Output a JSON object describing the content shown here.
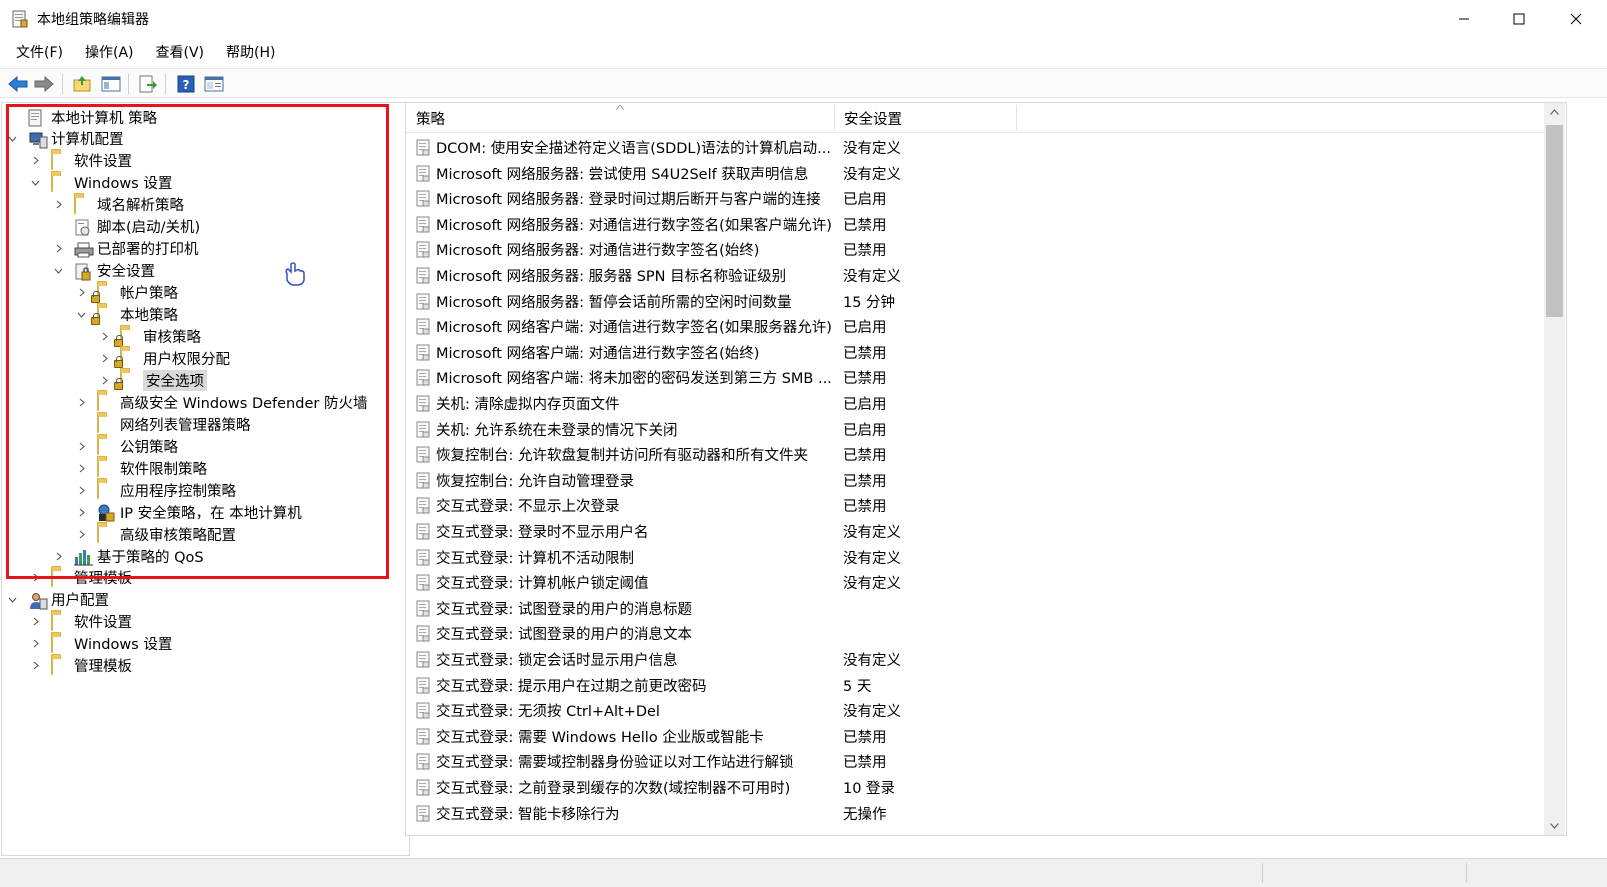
{
  "window": {
    "title": "本地组策略编辑器",
    "controls": [
      "minimize",
      "maximize",
      "close"
    ]
  },
  "menu": [
    "文件(F)",
    "操作(A)",
    "查看(V)",
    "帮助(H)"
  ],
  "toolbar": {
    "buttons": [
      "back-arrow-icon",
      "forward-arrow-icon",
      "up-folder-icon",
      "show-hide-tree-icon",
      "export-list-icon",
      "help-icon",
      "properties-icon"
    ]
  },
  "tree": [
    {
      "label": "本地计算机 策略",
      "icon": "policy-doc-icon",
      "depth": 0,
      "expander": "none"
    },
    {
      "label": "计算机配置",
      "icon": "computer-icon",
      "depth": 0,
      "expander": "expanded"
    },
    {
      "label": "软件设置",
      "icon": "folder-icon",
      "depth": 1,
      "expander": "collapsed"
    },
    {
      "label": "Windows 设置",
      "icon": "folder-icon",
      "depth": 1,
      "expander": "expanded"
    },
    {
      "label": "域名解析策略",
      "icon": "folder-icon",
      "depth": 2,
      "expander": "collapsed"
    },
    {
      "label": "脚本(启动/关机)",
      "icon": "script-icon",
      "depth": 2,
      "expander": "none"
    },
    {
      "label": "已部署的打印机",
      "icon": "printer-icon",
      "depth": 2,
      "expander": "collapsed"
    },
    {
      "label": "安全设置",
      "icon": "security-icon",
      "depth": 2,
      "expander": "expanded"
    },
    {
      "label": "帐户策略",
      "icon": "locked-folder-icon",
      "depth": 3,
      "expander": "collapsed"
    },
    {
      "label": "本地策略",
      "icon": "locked-folder-icon",
      "depth": 3,
      "expander": "expanded"
    },
    {
      "label": "审核策略",
      "icon": "locked-folder-icon",
      "depth": 4,
      "expander": "collapsed"
    },
    {
      "label": "用户权限分配",
      "icon": "locked-folder-icon",
      "depth": 4,
      "expander": "collapsed"
    },
    {
      "label": "安全选项",
      "icon": "locked-folder-icon",
      "depth": 4,
      "expander": "collapsed",
      "selected": true
    },
    {
      "label": "高级安全 Windows Defender 防火墙",
      "icon": "folder-icon",
      "depth": 3,
      "expander": "collapsed"
    },
    {
      "label": "网络列表管理器策略",
      "icon": "folder-icon",
      "depth": 3,
      "expander": "none"
    },
    {
      "label": "公钥策略",
      "icon": "folder-icon",
      "depth": 3,
      "expander": "collapsed"
    },
    {
      "label": "软件限制策略",
      "icon": "folder-icon",
      "depth": 3,
      "expander": "collapsed"
    },
    {
      "label": "应用程序控制策略",
      "icon": "folder-icon",
      "depth": 3,
      "expander": "collapsed"
    },
    {
      "label": "IP 安全策略，在 本地计算机",
      "icon": "ip-security-icon",
      "depth": 3,
      "expander": "collapsed"
    },
    {
      "label": "高级审核策略配置",
      "icon": "folder-icon",
      "depth": 3,
      "expander": "collapsed"
    },
    {
      "label": "基于策略的 QoS",
      "icon": "qos-chart-icon",
      "depth": 2,
      "expander": "collapsed"
    },
    {
      "label": "管理模板",
      "icon": "folder-icon",
      "depth": 1,
      "expander": "collapsed"
    },
    {
      "label": "用户配置",
      "icon": "user-icon",
      "depth": 0,
      "expander": "expanded"
    },
    {
      "label": "软件设置",
      "icon": "folder-icon",
      "depth": 1,
      "expander": "collapsed"
    },
    {
      "label": "Windows 设置",
      "icon": "folder-icon",
      "depth": 1,
      "expander": "collapsed"
    },
    {
      "label": "管理模板",
      "icon": "folder-icon",
      "depth": 1,
      "expander": "collapsed"
    }
  ],
  "list": {
    "columns": [
      "策略",
      "安全设置"
    ],
    "rows": [
      {
        "policy": "DCOM: 使用安全描述符定义语言(SDDL)语法的计算机启动...",
        "setting": "没有定义"
      },
      {
        "policy": "Microsoft 网络服务器: 尝试使用 S4U2Self 获取声明信息",
        "setting": "没有定义"
      },
      {
        "policy": "Microsoft 网络服务器: 登录时间过期后断开与客户端的连接",
        "setting": "已启用"
      },
      {
        "policy": "Microsoft 网络服务器: 对通信进行数字签名(如果客户端允许)",
        "setting": "已禁用"
      },
      {
        "policy": "Microsoft 网络服务器: 对通信进行数字签名(始终)",
        "setting": "已禁用"
      },
      {
        "policy": "Microsoft 网络服务器: 服务器 SPN 目标名称验证级别",
        "setting": "没有定义"
      },
      {
        "policy": "Microsoft 网络服务器: 暂停会话前所需的空闲时间数量",
        "setting": "15 分钟"
      },
      {
        "policy": "Microsoft 网络客户端: 对通信进行数字签名(如果服务器允许)",
        "setting": "已启用"
      },
      {
        "policy": "Microsoft 网络客户端: 对通信进行数字签名(始终)",
        "setting": "已禁用"
      },
      {
        "policy": "Microsoft 网络客户端: 将未加密的密码发送到第三方 SMB ...",
        "setting": "已禁用"
      },
      {
        "policy": "关机: 清除虚拟内存页面文件",
        "setting": "已启用"
      },
      {
        "policy": "关机: 允许系统在未登录的情况下关闭",
        "setting": "已启用"
      },
      {
        "policy": "恢复控制台: 允许软盘复制并访问所有驱动器和所有文件夹",
        "setting": "已禁用"
      },
      {
        "policy": "恢复控制台: 允许自动管理登录",
        "setting": "已禁用"
      },
      {
        "policy": "交互式登录: 不显示上次登录",
        "setting": "已禁用"
      },
      {
        "policy": "交互式登录: 登录时不显示用户名",
        "setting": "没有定义"
      },
      {
        "policy": "交互式登录: 计算机不活动限制",
        "setting": "没有定义"
      },
      {
        "policy": "交互式登录: 计算机帐户锁定阈值",
        "setting": "没有定义"
      },
      {
        "policy": "交互式登录: 试图登录的用户的消息标题",
        "setting": ""
      },
      {
        "policy": "交互式登录: 试图登录的用户的消息文本",
        "setting": ""
      },
      {
        "policy": "交互式登录: 锁定会话时显示用户信息",
        "setting": "没有定义"
      },
      {
        "policy": "交互式登录: 提示用户在过期之前更改密码",
        "setting": "5 天"
      },
      {
        "policy": "交互式登录: 无须按 Ctrl+Alt+Del",
        "setting": "没有定义"
      },
      {
        "policy": "交互式登录: 需要 Windows Hello 企业版或智能卡",
        "setting": "已禁用"
      },
      {
        "policy": "交互式登录: 需要域控制器身份验证以对工作站进行解锁",
        "setting": "已禁用"
      },
      {
        "policy": "交互式登录: 之前登录到缓存的次数(域控制器不可用时)",
        "setting": "10 登录"
      },
      {
        "policy": "交互式登录: 智能卡移除行为",
        "setting": "无操作"
      }
    ]
  },
  "colors": {
    "highlight_box": "#e8141c",
    "folder": "#f8d775",
    "selection": "#d9d9d9"
  }
}
